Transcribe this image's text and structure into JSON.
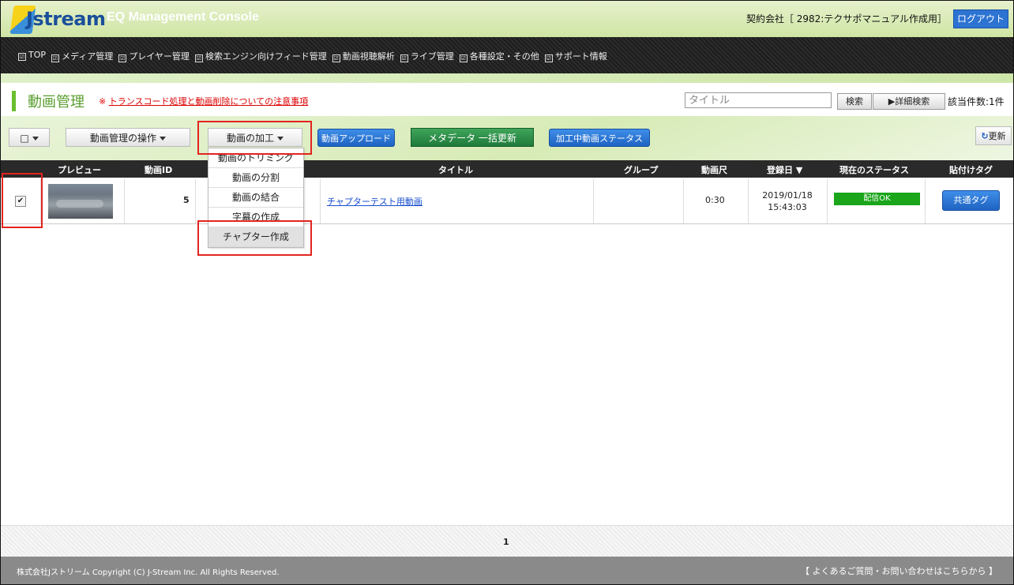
{
  "header": {
    "logo_text": "Jstream",
    "console_title": "EQ Management Console",
    "contract_label": "契約会社［ 2982:テクサポマニュアル作成用］",
    "logout_label": "ログアウト"
  },
  "nav": {
    "items": [
      "TOP",
      "メディア管理",
      "プレイヤー管理",
      "検索エンジン向けフィード管理",
      "動画視聴解析",
      "ライブ管理",
      "各種設定・その他",
      "サポート情報"
    ]
  },
  "page": {
    "title": "動画管理",
    "warning": "※",
    "warning_link": "トランスコード処理と動画削除についての注意事項",
    "search_placeholder": "タイトル",
    "search_button": "検索",
    "advanced_search": "▶詳細検索",
    "result_count": "該当件数:1件"
  },
  "toolbar": {
    "select_all": "□",
    "manage_ops": "動画管理の操作",
    "processing": "動画の加工",
    "upload": "動画アップロード",
    "metadata_bulk": "メタデータ 一括更新",
    "processing_status": "加工中動画ステータス",
    "refresh": "更新"
  },
  "dropdown": {
    "items": [
      "動画のトリミング",
      "動画の分割",
      "動画の結合",
      "字幕の作成",
      "チャプター作成"
    ],
    "selected_index": 4
  },
  "table": {
    "headers": [
      "プレビュー",
      "動画ID",
      "タイトル",
      "グループ",
      "動画尺",
      "登録日 ▼",
      "現在のステータス",
      "貼付けタグ"
    ],
    "rows": [
      {
        "checked": true,
        "id": "5",
        "title": "チャプターテスト用動画",
        "group": "",
        "duration": "0:30",
        "date": "2019/01/18",
        "time": "15:43:03",
        "status": "配信OK",
        "tag_button": "共通タグ"
      }
    ]
  },
  "pager": {
    "current": "1"
  },
  "footer": {
    "copyright": "株式会社Jストリーム Copyright (C) J-Stream Inc. All Rights Reserved.",
    "faq": "【 よくあるご質問・お問い合わせはこちらから 】"
  },
  "colors": {
    "accent_green": "#6abf2f",
    "primary_blue": "#2c73d2",
    "status_green": "#1aa51a",
    "highlight_red": "#e2241f"
  }
}
